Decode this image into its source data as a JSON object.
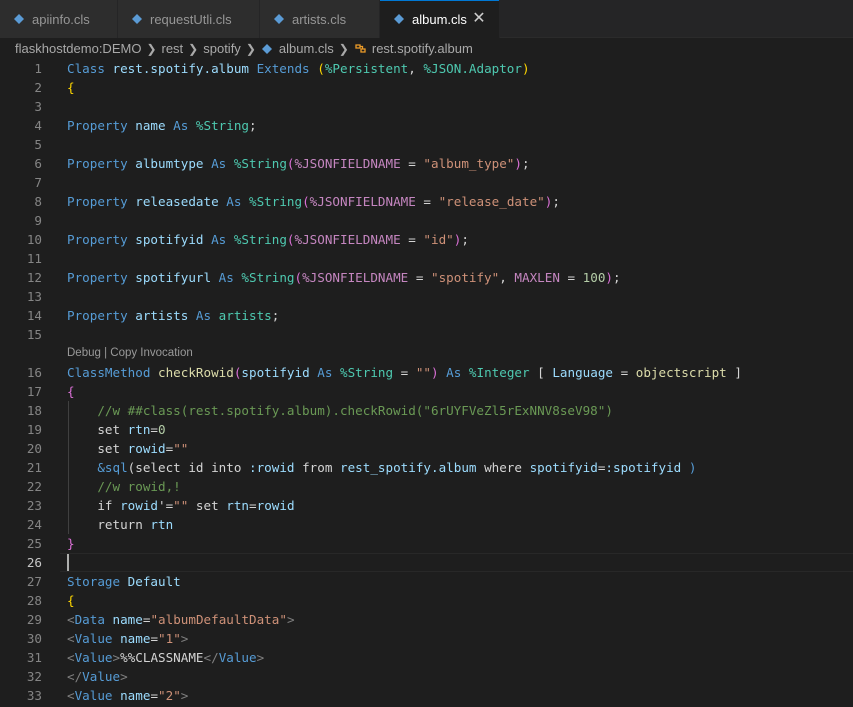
{
  "tabs": [
    {
      "label": "apiinfo.cls",
      "active": false,
      "width": 118
    },
    {
      "label": "requestUtli.cls",
      "active": false,
      "width": 142
    },
    {
      "label": "artists.cls",
      "active": false,
      "width": 120
    },
    {
      "label": "album.cls",
      "active": true,
      "width": 120
    }
  ],
  "close_glyph": "✕",
  "breadcrumb": {
    "items": [
      "flaskhostdemo:DEMO",
      "rest",
      "spotify",
      "album.cls",
      "rest.spotify.album"
    ]
  },
  "codelens": "Debug | Copy Invocation",
  "current_line": 26,
  "lines": [
    {
      "n": "1",
      "tokens": [
        [
          "Class ",
          "t-kw"
        ],
        [
          "rest.spotify.album ",
          "t-name"
        ],
        [
          "Extends ",
          "t-kw"
        ],
        [
          "(",
          "t-brace"
        ],
        [
          "%Persistent",
          "t-type"
        ],
        [
          ", ",
          "t-plain"
        ],
        [
          "%JSON.Adaptor",
          "t-type"
        ],
        [
          ")",
          "t-brace"
        ]
      ]
    },
    {
      "n": "2",
      "tokens": [
        [
          "{",
          "t-brace"
        ]
      ]
    },
    {
      "n": "3",
      "tokens": []
    },
    {
      "n": "4",
      "tokens": [
        [
          "Property ",
          "t-kw"
        ],
        [
          "name ",
          "t-name"
        ],
        [
          "As ",
          "t-kw"
        ],
        [
          "%String",
          "t-type"
        ],
        [
          ";",
          "t-plain"
        ]
      ]
    },
    {
      "n": "5",
      "tokens": []
    },
    {
      "n": "6",
      "tokens": [
        [
          "Property ",
          "t-kw"
        ],
        [
          "albumtype ",
          "t-name"
        ],
        [
          "As ",
          "t-kw"
        ],
        [
          "%String",
          "t-type"
        ],
        [
          "(",
          "t-brace2"
        ],
        [
          "%JSONFIELDNAME",
          "t-mac"
        ],
        [
          " = ",
          "t-plain"
        ],
        [
          "\"album_type\"",
          "t-str"
        ],
        [
          ")",
          "t-brace2"
        ],
        [
          ";",
          "t-plain"
        ]
      ]
    },
    {
      "n": "7",
      "tokens": []
    },
    {
      "n": "8",
      "tokens": [
        [
          "Property ",
          "t-kw"
        ],
        [
          "releasedate ",
          "t-name"
        ],
        [
          "As ",
          "t-kw"
        ],
        [
          "%String",
          "t-type"
        ],
        [
          "(",
          "t-brace2"
        ],
        [
          "%JSONFIELDNAME",
          "t-mac"
        ],
        [
          " = ",
          "t-plain"
        ],
        [
          "\"release_date\"",
          "t-str"
        ],
        [
          ")",
          "t-brace2"
        ],
        [
          ";",
          "t-plain"
        ]
      ]
    },
    {
      "n": "9",
      "tokens": []
    },
    {
      "n": "10",
      "tokens": [
        [
          "Property ",
          "t-kw"
        ],
        [
          "spotifyid ",
          "t-name"
        ],
        [
          "As ",
          "t-kw"
        ],
        [
          "%String",
          "t-type"
        ],
        [
          "(",
          "t-brace2"
        ],
        [
          "%JSONFIELDNAME",
          "t-mac"
        ],
        [
          " = ",
          "t-plain"
        ],
        [
          "\"id\"",
          "t-str"
        ],
        [
          ")",
          "t-brace2"
        ],
        [
          ";",
          "t-plain"
        ]
      ]
    },
    {
      "n": "11",
      "tokens": []
    },
    {
      "n": "12",
      "tokens": [
        [
          "Property ",
          "t-kw"
        ],
        [
          "spotifyurl ",
          "t-name"
        ],
        [
          "As ",
          "t-kw"
        ],
        [
          "%String",
          "t-type"
        ],
        [
          "(",
          "t-brace2"
        ],
        [
          "%JSONFIELDNAME",
          "t-mac"
        ],
        [
          " = ",
          "t-plain"
        ],
        [
          "\"spotify\"",
          "t-str"
        ],
        [
          ", ",
          "t-plain"
        ],
        [
          "MAXLEN",
          "t-mac"
        ],
        [
          " = ",
          "t-plain"
        ],
        [
          "100",
          "t-num"
        ],
        [
          ")",
          "t-brace2"
        ],
        [
          ";",
          "t-plain"
        ]
      ]
    },
    {
      "n": "13",
      "tokens": []
    },
    {
      "n": "14",
      "tokens": [
        [
          "Property ",
          "t-kw"
        ],
        [
          "artists ",
          "t-name"
        ],
        [
          "As ",
          "t-kw"
        ],
        [
          "artists",
          "t-type"
        ],
        [
          ";",
          "t-plain"
        ]
      ]
    },
    {
      "n": "15",
      "tokens": []
    },
    {
      "n": "16",
      "tokens": [
        [
          "ClassMethod ",
          "t-kw"
        ],
        [
          "checkRowid",
          "t-fn"
        ],
        [
          "(",
          "t-brace2"
        ],
        [
          "spotifyid ",
          "t-name"
        ],
        [
          "As ",
          "t-kw"
        ],
        [
          "%String",
          "t-type"
        ],
        [
          " = ",
          "t-plain"
        ],
        [
          "\"\"",
          "t-str"
        ],
        [
          ") ",
          "t-brace2"
        ],
        [
          "As ",
          "t-kw"
        ],
        [
          "%Integer ",
          "t-type"
        ],
        [
          "[ ",
          "t-plain"
        ],
        [
          "Language",
          "t-name"
        ],
        [
          " = ",
          "t-plain"
        ],
        [
          "objectscript",
          "t-fn"
        ],
        [
          " ]",
          "t-plain"
        ]
      ]
    },
    {
      "n": "17",
      "tokens": [
        [
          "{",
          "t-brace2"
        ]
      ]
    },
    {
      "n": "18",
      "tokens": [
        [
          "    //w ##class(rest.spotify.album).checkRowid(\"6rUYFVeZl5rExNNV8seV98\")",
          "t-com"
        ]
      ]
    },
    {
      "n": "19",
      "tokens": [
        [
          "    set ",
          "t-plain"
        ],
        [
          "rtn",
          "t-name"
        ],
        [
          "=",
          "t-plain"
        ],
        [
          "0",
          "t-num"
        ]
      ]
    },
    {
      "n": "20",
      "tokens": [
        [
          "    set ",
          "t-plain"
        ],
        [
          "rowid",
          "t-name"
        ],
        [
          "=",
          "t-plain"
        ],
        [
          "\"\"",
          "t-str"
        ]
      ]
    },
    {
      "n": "21",
      "tokens": [
        [
          "    &sql",
          "t-kw"
        ],
        [
          "(",
          "t-plain"
        ],
        [
          "select id into ",
          "t-plain"
        ],
        [
          ":rowid ",
          "t-name"
        ],
        [
          "from ",
          "t-plain"
        ],
        [
          "rest_spotify.album ",
          "t-name"
        ],
        [
          "where ",
          "t-plain"
        ],
        [
          "spotifyid",
          "t-name"
        ],
        [
          "=",
          "t-plain"
        ],
        [
          ":spotifyid ",
          "t-name"
        ],
        [
          ")",
          "t-kw"
        ]
      ]
    },
    {
      "n": "22",
      "tokens": [
        [
          "    //w rowid,!",
          "t-com"
        ]
      ]
    },
    {
      "n": "23",
      "tokens": [
        [
          "    if ",
          "t-plain"
        ],
        [
          "rowid",
          "t-name"
        ],
        [
          "'=",
          "t-plain"
        ],
        [
          "\"\"",
          "t-str"
        ],
        [
          " set ",
          "t-plain"
        ],
        [
          "rtn",
          "t-name"
        ],
        [
          "=",
          "t-plain"
        ],
        [
          "rowid",
          "t-name"
        ]
      ]
    },
    {
      "n": "24",
      "tokens": [
        [
          "    return ",
          "t-plain"
        ],
        [
          "rtn",
          "t-name"
        ]
      ]
    },
    {
      "n": "25",
      "tokens": [
        [
          "}",
          "t-brace2"
        ]
      ]
    },
    {
      "n": "26",
      "tokens": []
    },
    {
      "n": "27",
      "tokens": [
        [
          "Storage ",
          "t-kw"
        ],
        [
          "Default",
          "t-name"
        ]
      ]
    },
    {
      "n": "28",
      "tokens": [
        [
          "{",
          "t-brace"
        ]
      ]
    },
    {
      "n": "29",
      "tokens": [
        [
          "<",
          "t-gray"
        ],
        [
          "Data ",
          "t-tag"
        ],
        [
          "name",
          "t-attr"
        ],
        [
          "=",
          "t-plain"
        ],
        [
          "\"albumDefaultData\"",
          "t-str"
        ],
        [
          ">",
          "t-gray"
        ]
      ]
    },
    {
      "n": "30",
      "tokens": [
        [
          "<",
          "t-gray"
        ],
        [
          "Value ",
          "t-tag"
        ],
        [
          "name",
          "t-attr"
        ],
        [
          "=",
          "t-plain"
        ],
        [
          "\"1\"",
          "t-str"
        ],
        [
          ">",
          "t-gray"
        ]
      ]
    },
    {
      "n": "31",
      "tokens": [
        [
          "<",
          "t-gray"
        ],
        [
          "Value",
          "t-tag"
        ],
        [
          ">",
          "t-gray"
        ],
        [
          "%%CLASSNAME",
          "t-plain"
        ],
        [
          "</",
          "t-gray"
        ],
        [
          "Value",
          "t-tag"
        ],
        [
          ">",
          "t-gray"
        ]
      ]
    },
    {
      "n": "32",
      "tokens": [
        [
          "</",
          "t-gray"
        ],
        [
          "Value",
          "t-tag"
        ],
        [
          ">",
          "t-gray"
        ]
      ]
    },
    {
      "n": "33",
      "tokens": [
        [
          "<",
          "t-gray"
        ],
        [
          "Value ",
          "t-tag"
        ],
        [
          "name",
          "t-attr"
        ],
        [
          "=",
          "t-plain"
        ],
        [
          "\"2\"",
          "t-str"
        ],
        [
          ">",
          "t-gray"
        ]
      ]
    }
  ]
}
